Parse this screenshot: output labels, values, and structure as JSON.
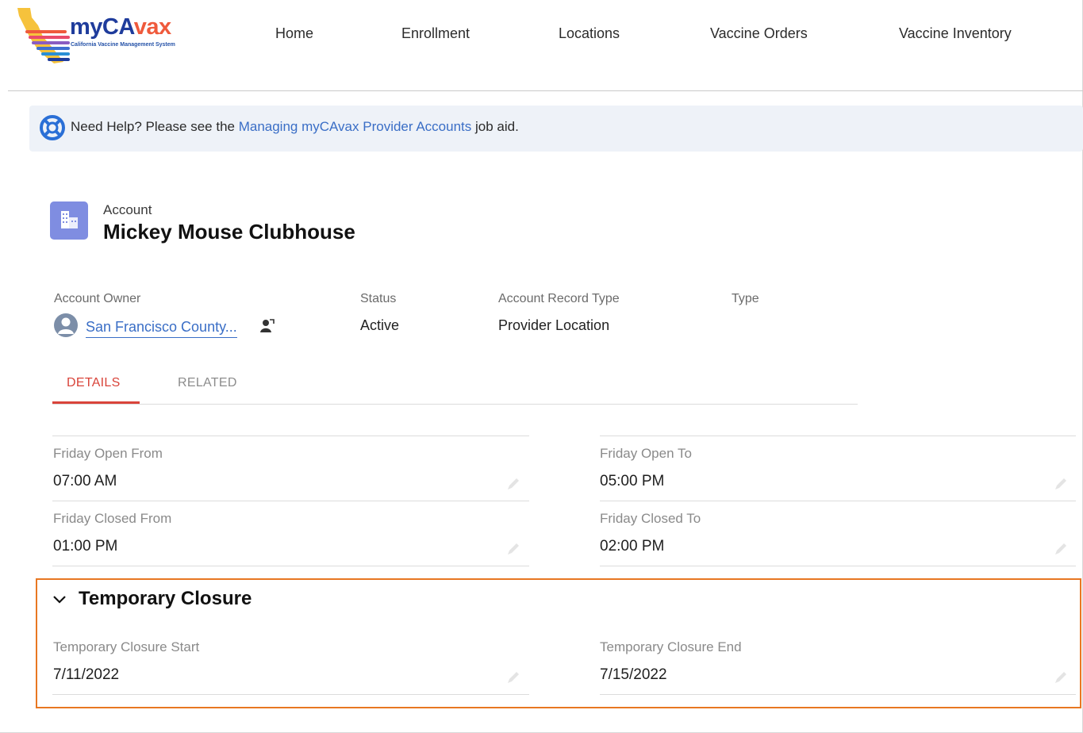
{
  "header": {
    "logo": {
      "brand_my": "my",
      "brand_ca": "CA",
      "brand_vax": "vax",
      "subtitle": "California Vaccine Management System"
    },
    "nav": [
      "Home",
      "Enrollment",
      "Locations",
      "Vaccine Orders",
      "Vaccine Inventory"
    ]
  },
  "help": {
    "prefix": "Need Help? Please see the ",
    "link": "Managing myCAvax Provider Accounts",
    "suffix": " job aid."
  },
  "record": {
    "object_label": "Account",
    "name": "Mickey Mouse Clubhouse",
    "highlights": {
      "owner_label": "Account Owner",
      "owner_value": "San Francisco County...",
      "status_label": "Status",
      "status_value": "Active",
      "record_type_label": "Account Record Type",
      "record_type_value": "Provider Location",
      "type_label": "Type"
    }
  },
  "tabs": {
    "details": "DETAILS",
    "related": "RELATED"
  },
  "fields": {
    "friday_open_from": {
      "label": "Friday Open From",
      "value": "07:00 AM"
    },
    "friday_open_to": {
      "label": "Friday Open To",
      "value": "05:00 PM"
    },
    "friday_closed_from": {
      "label": "Friday Closed From",
      "value": "01:00 PM"
    },
    "friday_closed_to": {
      "label": "Friday Closed To",
      "value": "02:00 PM"
    }
  },
  "section": {
    "title": "Temporary Closure",
    "start": {
      "label": "Temporary Closure Start",
      "value": "7/11/2022"
    },
    "end": {
      "label": "Temporary Closure End",
      "value": "7/15/2022"
    }
  },
  "colors": {
    "accent_red": "#d9443a",
    "link_blue": "#3a6ec6",
    "highlight_orange": "#e87722",
    "account_icon": "#7f8de1"
  }
}
